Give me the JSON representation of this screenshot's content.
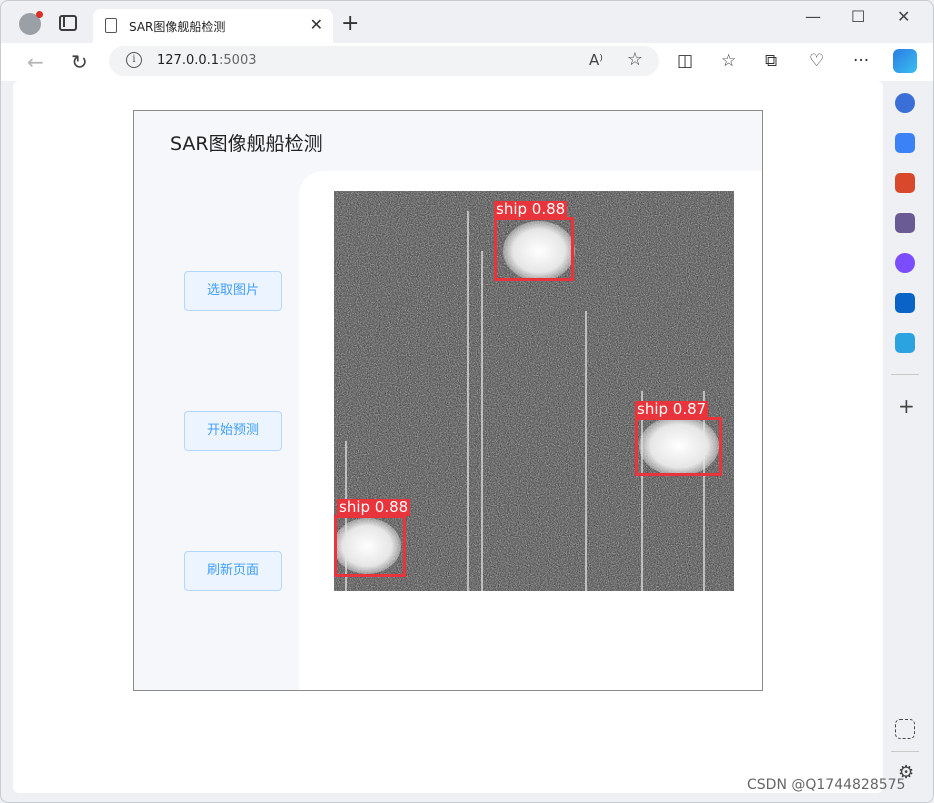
{
  "browser": {
    "tab_title": "SAR图像舰船检测",
    "url_host": "127.0.0.1",
    "url_port": ":5003",
    "read_aloud_glyph": "A⁾",
    "icons": [
      "profile-icon",
      "tab-actions-icon",
      "back-icon",
      "refresh-icon",
      "info-icon",
      "read-aloud-icon",
      "favorite-star-icon",
      "split-screen-icon",
      "favorites-icon",
      "collections-icon",
      "performance-icon",
      "more-icon",
      "copilot-icon"
    ]
  },
  "sidebar": {
    "icons": [
      "search-icon",
      "shopping-icon",
      "tools-icon",
      "games-icon",
      "microsoft365-icon",
      "outlook-icon",
      "telegram-icon",
      "add-icon",
      "screenshot-icon",
      "settings-icon"
    ]
  },
  "app": {
    "title": "SAR图像舰船检测",
    "buttons": {
      "select": "选取图片",
      "predict": "开始预测",
      "refresh": "刷新页面"
    },
    "detections": [
      {
        "label": "ship  0.88",
        "class": "ship",
        "score": 0.88
      },
      {
        "label": "ship  0.87",
        "class": "ship",
        "score": 0.87
      },
      {
        "label": "ship  0.88",
        "class": "ship",
        "score": 0.88
      }
    ]
  },
  "watermark": "CSDN @Q1744828575",
  "colors": {
    "button_bg": "#ecf5ff",
    "button_border": "#b3d8ff",
    "button_text": "#409eff",
    "bbox": "#e8343a"
  }
}
